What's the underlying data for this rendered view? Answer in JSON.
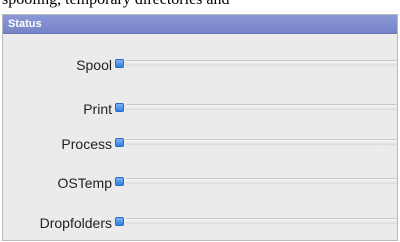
{
  "top_text": "spooling, temporary directories and",
  "panel": {
    "title": "Status",
    "rows": [
      {
        "label": "Spool",
        "status_icon": "blue-status-indicator"
      },
      {
        "label": "Print",
        "status_icon": "blue-status-indicator"
      },
      {
        "label": "Process",
        "status_icon": "blue-status-indicator"
      },
      {
        "label": "OSTemp",
        "status_icon": "blue-status-indicator"
      },
      {
        "label": "Dropfolders",
        "status_icon": "blue-status-indicator"
      }
    ]
  },
  "colors": {
    "header_bg": "#7886c8",
    "indicator": "#2f7fe0",
    "panel_bg": "#ebebeb"
  }
}
